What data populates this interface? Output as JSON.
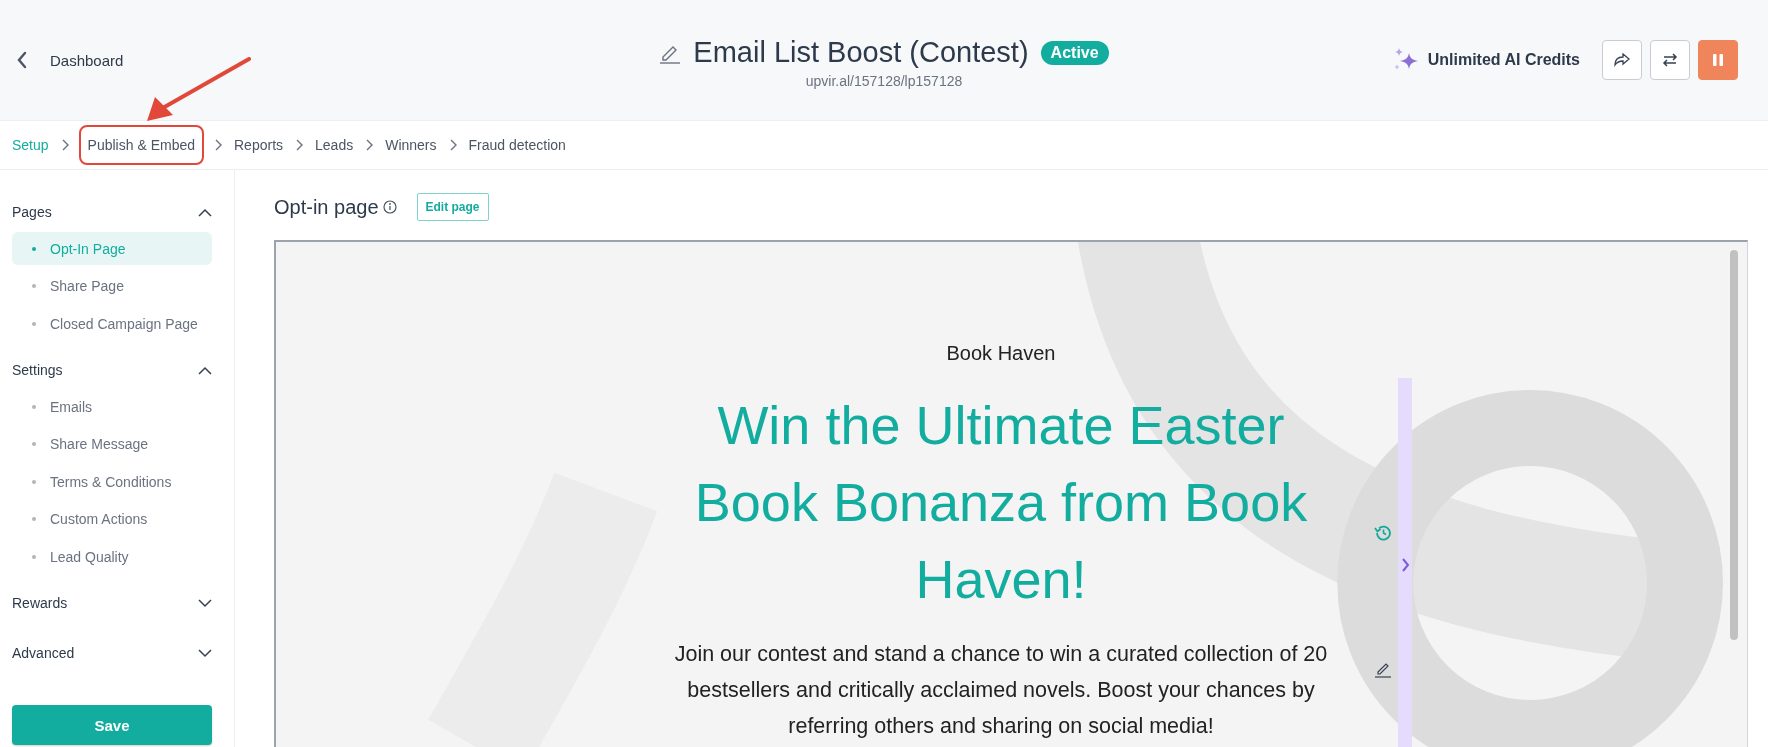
{
  "header": {
    "back_label": "Dashboard",
    "title": "Email List Boost (Contest)",
    "status": "Active",
    "url": "upvir.al/157128/lp157128",
    "ai_credits": "Unlimited AI Credits"
  },
  "steps": [
    {
      "label": "Setup",
      "selected": true,
      "highlighted": false
    },
    {
      "label": "Publish & Embed",
      "selected": false,
      "highlighted": true
    },
    {
      "label": "Reports",
      "selected": false,
      "highlighted": false
    },
    {
      "label": "Leads",
      "selected": false,
      "highlighted": false
    },
    {
      "label": "Winners",
      "selected": false,
      "highlighted": false
    },
    {
      "label": "Fraud detection",
      "selected": false,
      "highlighted": false
    }
  ],
  "sidebar": {
    "sections": [
      {
        "title": "Pages",
        "expanded": true,
        "items": [
          {
            "label": "Opt-In Page",
            "selected": true
          },
          {
            "label": "Share Page",
            "selected": false
          },
          {
            "label": "Closed Campaign Page",
            "selected": false
          }
        ]
      },
      {
        "title": "Settings",
        "expanded": true,
        "items": [
          {
            "label": "Emails",
            "selected": false
          },
          {
            "label": "Share Message",
            "selected": false
          },
          {
            "label": "Terms & Conditions",
            "selected": false
          },
          {
            "label": "Custom Actions",
            "selected": false
          },
          {
            "label": "Lead Quality",
            "selected": false
          }
        ]
      },
      {
        "title": "Rewards",
        "expanded": false
      },
      {
        "title": "Advanced",
        "expanded": false
      }
    ],
    "save_label": "Save"
  },
  "main": {
    "title": "Opt-in page",
    "edit_label": "Edit page"
  },
  "preview": {
    "brand": "Book Haven",
    "headline": "Win the Ultimate Easter Book Bonanza from Book Haven!",
    "body": "Join our contest and stand a chance to win a curated collection of 20 bestsellers and critically acclaimed novels. Boost your chances by referring others and sharing on social media!"
  }
}
